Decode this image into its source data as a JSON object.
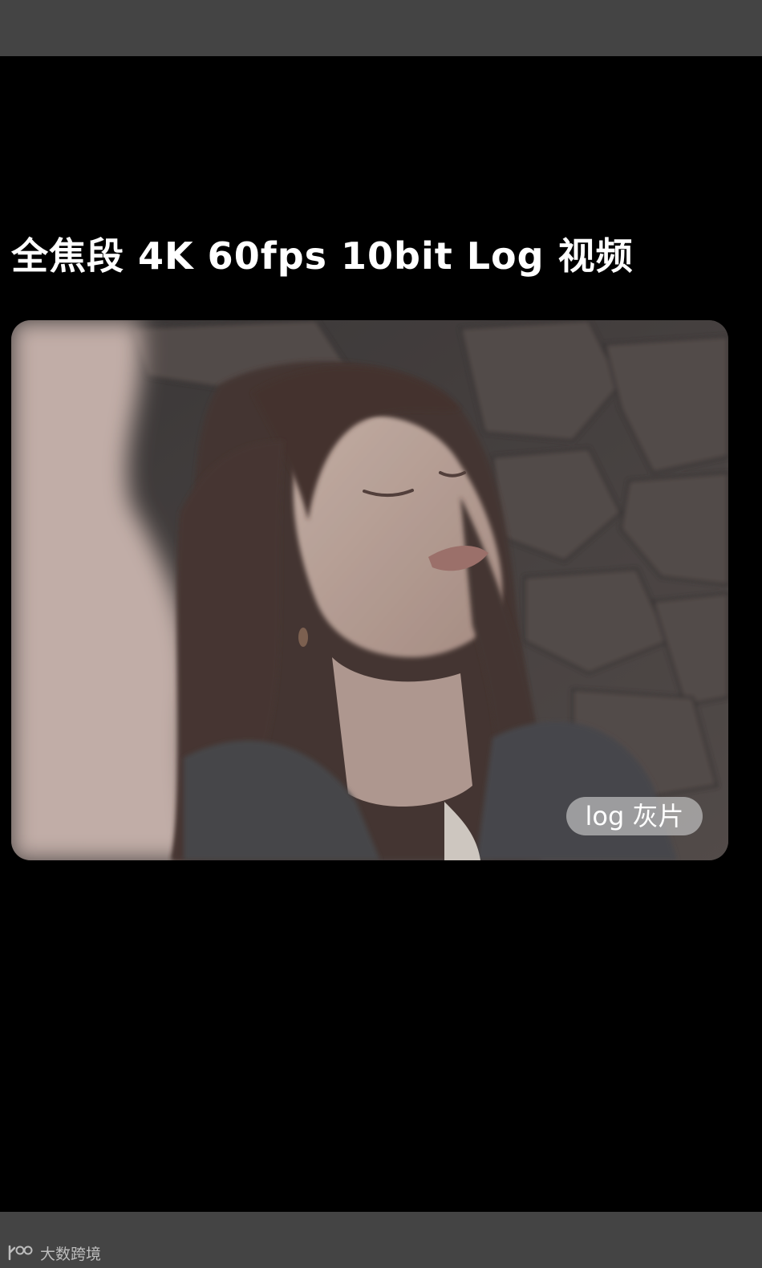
{
  "headline": "全焦段 4K 60fps 10bit Log 视频",
  "photo": {
    "badge_label": "log 灰片"
  },
  "watermark": {
    "brand": "大数跨境"
  },
  "colors": {
    "frame_bars": "#444444",
    "background": "#000000",
    "headline": "#ffffff",
    "badge_bg": "#bebebe"
  }
}
